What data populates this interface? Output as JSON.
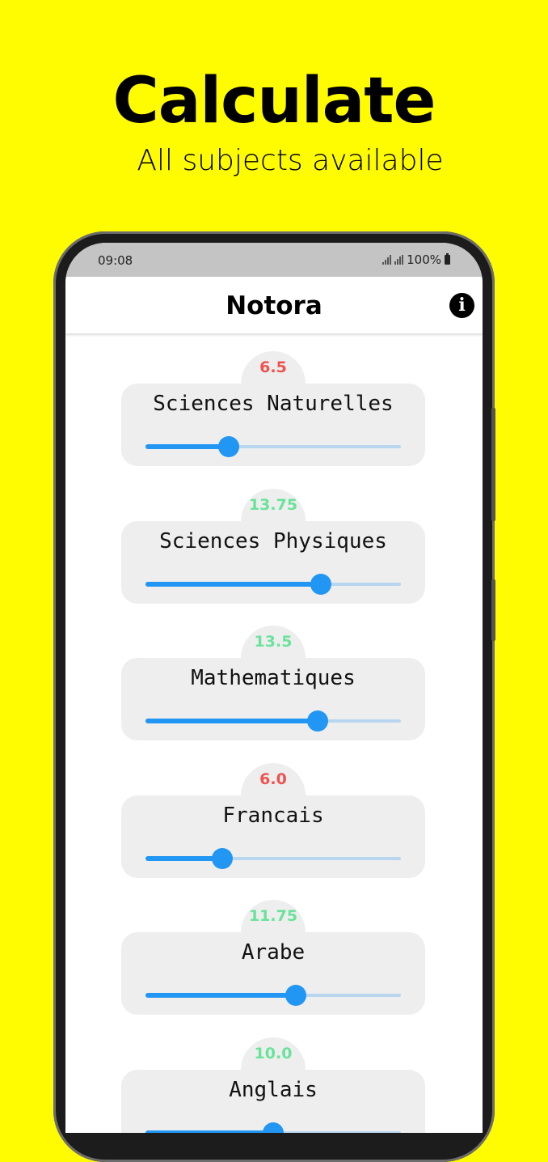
{
  "promo": {
    "title": "Calculate",
    "subtitle": "All subjects available"
  },
  "status_bar": {
    "time": "09:08",
    "battery": "100%"
  },
  "app_bar": {
    "title": "Notora",
    "info_icon": "info-icon",
    "info_glyph": "i"
  },
  "colors": {
    "background": "#fffb00",
    "accent": "#2196f3",
    "grade_low": "#ef5350",
    "grade_high": "#69e39b"
  },
  "scale": {
    "min": 0,
    "max": 20
  },
  "subjects": [
    {
      "name": "Sciences Naturelles",
      "grade": "6.5",
      "value": 6.5,
      "status": "low"
    },
    {
      "name": "Sciences Physiques",
      "grade": "13.75",
      "value": 13.75,
      "status": "high"
    },
    {
      "name": "Mathematiques",
      "grade": "13.5",
      "value": 13.5,
      "status": "high"
    },
    {
      "name": "Francais",
      "grade": "6.0",
      "value": 6.0,
      "status": "low"
    },
    {
      "name": "Arabe",
      "grade": "11.75",
      "value": 11.75,
      "status": "high"
    },
    {
      "name": "Anglais",
      "grade": "10.0",
      "value": 10.0,
      "status": "high"
    }
  ]
}
